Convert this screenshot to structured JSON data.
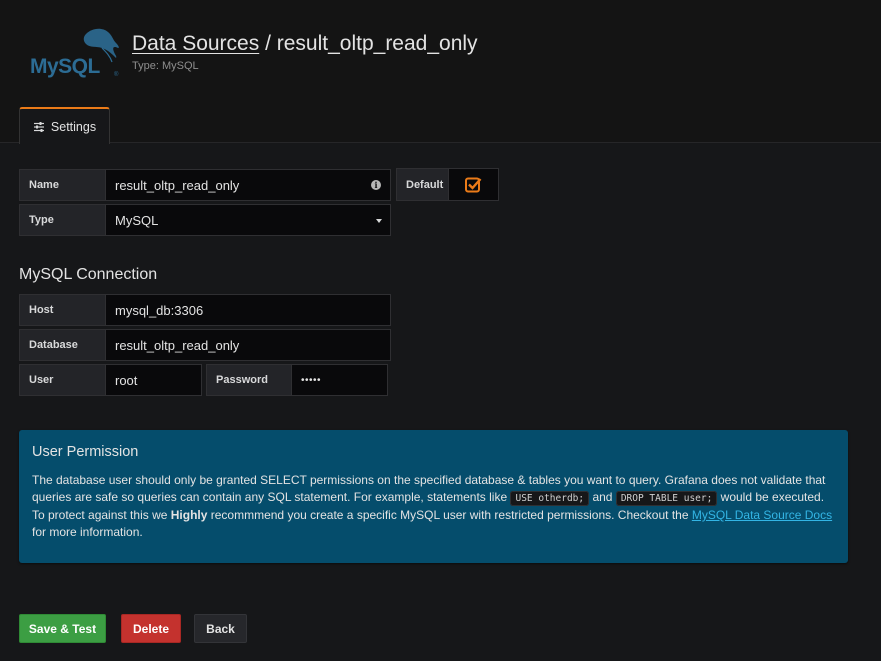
{
  "header": {
    "logo_text": "MySQL",
    "breadcrumb_link": "Data Sources",
    "separator": " / ",
    "datasource_name": "result_oltp_read_only",
    "subtitle": "Type: MySQL"
  },
  "tabs": [
    {
      "label": "Settings",
      "icon": "sliders-icon",
      "active": true
    }
  ],
  "settings": {
    "name_label": "Name",
    "name_value": "result_oltp_read_only",
    "default_label": "Default",
    "default_checked": true,
    "type_label": "Type",
    "type_value": "MySQL"
  },
  "connection": {
    "title": "MySQL Connection",
    "host_label": "Host",
    "host_value": "mysql_db:3306",
    "database_label": "Database",
    "database_value": "result_oltp_read_only",
    "user_label": "User",
    "user_value": "root",
    "password_label": "Password",
    "password_value": "•••••"
  },
  "permission": {
    "title": "User Permission",
    "text_1": "The database user should only be granted SELECT permissions on the specified database & tables you want to query. Grafana does not validate that queries are safe so queries can contain any SQL statement. For example, statements like ",
    "code_1": "USE otherdb;",
    "text_2": " and ",
    "code_2": "DROP TABLE user;",
    "text_3": " would be executed. To protect against this we ",
    "bold": "Highly",
    "text_4": " recommmend you create a specific MySQL user with restricted permissions. Checkout the ",
    "link": "MySQL Data Source Docs",
    "text_5": " for more information."
  },
  "buttons": {
    "save": "Save & Test",
    "delete": "Delete",
    "back": "Back"
  },
  "colors": {
    "accent": "#eb7b18",
    "save": "#3c9e43",
    "delete": "#c4322e",
    "alert_bg": "#054d6c",
    "link": "#33b5e5"
  }
}
